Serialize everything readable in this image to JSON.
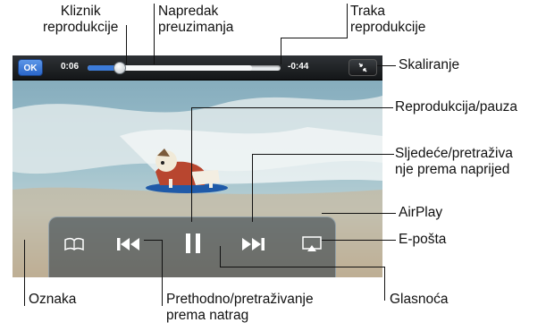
{
  "player": {
    "ok_label": "OK",
    "elapsed": "0:06",
    "remaining": "-0:44",
    "playback_progress": 0.16,
    "download_progress": 0.85,
    "volume_level": 0.77
  },
  "annotations": {
    "kliznik": [
      "Kliznik",
      "reprodukcije"
    ],
    "napredak": [
      "Napredak",
      "preuzimanja"
    ],
    "traka": [
      "Traka",
      "reprodukcije"
    ],
    "skaliranje": "Skaliranje",
    "play_pause": "Reprodukcija/pauza",
    "next": [
      "Sljedeće/pretraživa",
      "nje prema naprijed"
    ],
    "airplay": "AirPlay",
    "email": "E-pošta",
    "oznaka": "Oznaka",
    "previous": [
      "Prethodno/pretraživanje",
      "prema natrag"
    ],
    "glasnoca": "Glasnoća"
  },
  "icons": {
    "bookmark": "open-book-icon",
    "previous": "skip-back-icon",
    "pause": "pause-icon",
    "next": "skip-forward-icon",
    "airplay": "airplay-icon",
    "email": "envelope-icon",
    "scale": "shrink-arrows-icon"
  }
}
